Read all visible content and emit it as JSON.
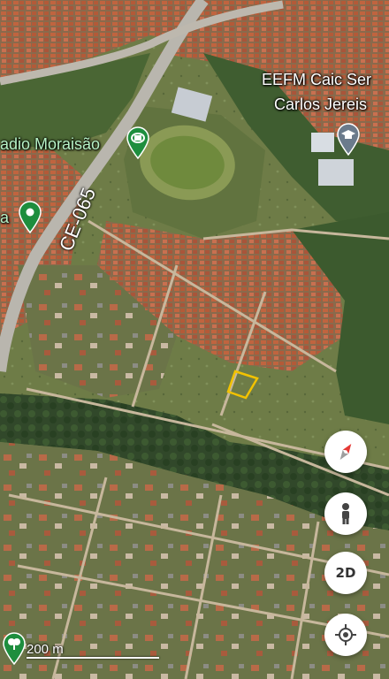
{
  "map": {
    "labels": {
      "school_line1": "EEFM Caic Ser",
      "school_line2": "Carlos Jereis",
      "stadium": "adio Moraisão",
      "road": "CE-065",
      "edge_letter": "a"
    },
    "scale": {
      "text": "200 m"
    },
    "controls": {
      "compass": "compass-icon",
      "street_view": "pegman-icon",
      "mode_label": "2D",
      "locate": "my-location-icon"
    },
    "poi_icons": {
      "school": "graduation-cap-icon",
      "stadium": "stadium-icon",
      "place": "place-pin-icon",
      "park": "park-icon"
    },
    "colors": {
      "vegetation": "#4f6a35",
      "dark_forest": "#2f4524",
      "roofs": "#b9603e",
      "road": "#b8b4ac",
      "selection": "#f2c200",
      "poi_green": "#1e8e3e",
      "poi_grey": "#6b7b8c",
      "compass_red": "#e53935"
    }
  }
}
